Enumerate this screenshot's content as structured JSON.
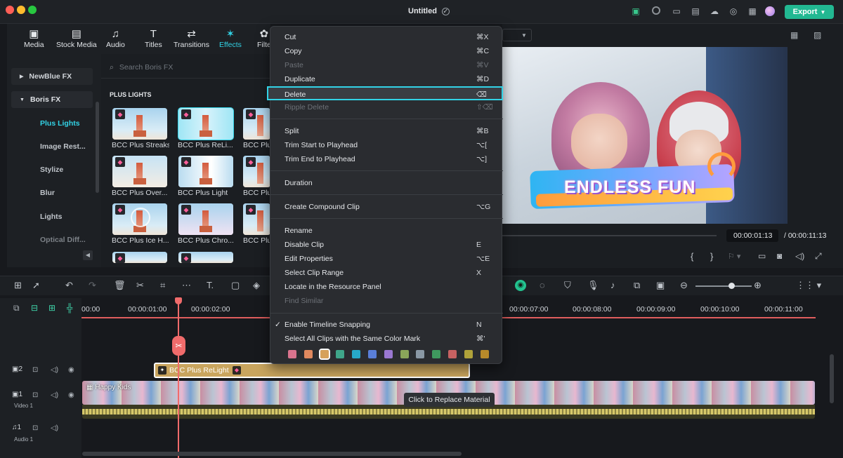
{
  "window": {
    "title": "Untitled",
    "export_label": "Export"
  },
  "toolbar": {
    "tabs": [
      {
        "label": "Media",
        "icon": "media-icon"
      },
      {
        "label": "Stock Media",
        "icon": "stock-media-icon"
      },
      {
        "label": "Audio",
        "icon": "audio-icon"
      },
      {
        "label": "Titles",
        "icon": "titles-icon"
      },
      {
        "label": "Transitions",
        "icon": "transitions-icon"
      },
      {
        "label": "Effects",
        "icon": "effects-icon",
        "active": true
      },
      {
        "label": "Filte",
        "icon": "filters-icon"
      }
    ]
  },
  "sidebar": {
    "items": [
      {
        "label": "NewBlue FX",
        "type": "group-collapsed"
      },
      {
        "label": "Boris FX",
        "type": "group-expanded"
      },
      {
        "label": "Plus Lights",
        "active": true
      },
      {
        "label": "Image Rest..."
      },
      {
        "label": "Stylize"
      },
      {
        "label": "Blur"
      },
      {
        "label": "Lights"
      },
      {
        "label": "Optical Diff..."
      }
    ]
  },
  "effects": {
    "search_placeholder": "Search Boris FX",
    "section_title": "PLUS LIGHTS",
    "items": [
      {
        "label": "BCC Plus Streaks"
      },
      {
        "label": "BCC Plus ReLi..."
      },
      {
        "label": "BCC Plu"
      },
      {
        "label": "BCC Plus Over..."
      },
      {
        "label": "BCC Plus Light"
      },
      {
        "label": "BCC Plu"
      },
      {
        "label": "BCC Plus Ice H..."
      },
      {
        "label": "BCC Plus Chro..."
      },
      {
        "label": "BCC Plu"
      }
    ]
  },
  "context_menu": {
    "items": [
      {
        "label": "Cut",
        "shortcut": "⌘X"
      },
      {
        "label": "Copy",
        "shortcut": "⌘C"
      },
      {
        "label": "Paste",
        "shortcut": "⌘V",
        "disabled": true
      },
      {
        "label": "Duplicate",
        "shortcut": "⌘D"
      },
      {
        "label": "Delete",
        "shortcut": "⌫",
        "selected": true
      },
      {
        "label": "Ripple Delete",
        "shortcut": "⇧⌫",
        "disabled": true
      },
      {
        "label": "Split",
        "shortcut": "⌘B"
      },
      {
        "label": "Trim Start to Playhead",
        "shortcut": "⌥["
      },
      {
        "label": "Trim End to Playhead",
        "shortcut": "⌥]"
      },
      {
        "label": "Duration",
        "shortcut": ""
      },
      {
        "label": "Create Compound Clip",
        "shortcut": "⌥G"
      },
      {
        "label": "Rename",
        "shortcut": ""
      },
      {
        "label": "Disable Clip",
        "shortcut": "E"
      },
      {
        "label": "Edit Properties",
        "shortcut": "⌥E"
      },
      {
        "label": "Select Clip Range",
        "shortcut": "X"
      },
      {
        "label": "Locate in the Resource Panel",
        "shortcut": ""
      },
      {
        "label": "Find Similar",
        "shortcut": "",
        "disabled": true
      },
      {
        "label": "Enable Timeline Snapping",
        "shortcut": "N",
        "checked": true
      },
      {
        "label": "Select All Clips with the Same Color Mark",
        "shortcut": "⌘'"
      }
    ],
    "color_marks": [
      "#d9738d",
      "#e0895f",
      "#d6a15a",
      "#3fa68a",
      "#27a9c9",
      "#5a7fd8",
      "#9a78d2",
      "#8aa55a",
      "#8a98a5",
      "#3f9a5f",
      "#c76262",
      "#b0a23a",
      "#b88a2a"
    ]
  },
  "preview": {
    "overlay_text": "ENDLESS FUN",
    "current_time": "00:00:01:13",
    "total_time": "/ 00:00:11:13"
  },
  "timeline": {
    "ruler": [
      "00:00",
      "00:00:01:00",
      "00:00:02:00",
      "00:00:07:00",
      "00:00:08:00",
      "00:00:09:00",
      "00:00:10:00",
      "00:00:11:00"
    ],
    "effect_clip_label": "BCC Plus ReLight",
    "video_clip_label": "Happy Kids",
    "tooltip": "Click to Replace Material",
    "tracks": [
      {
        "number": "2",
        "name": ""
      },
      {
        "number": "1",
        "name": "Video 1"
      },
      {
        "number": "1",
        "name": "Audio 1"
      }
    ]
  }
}
